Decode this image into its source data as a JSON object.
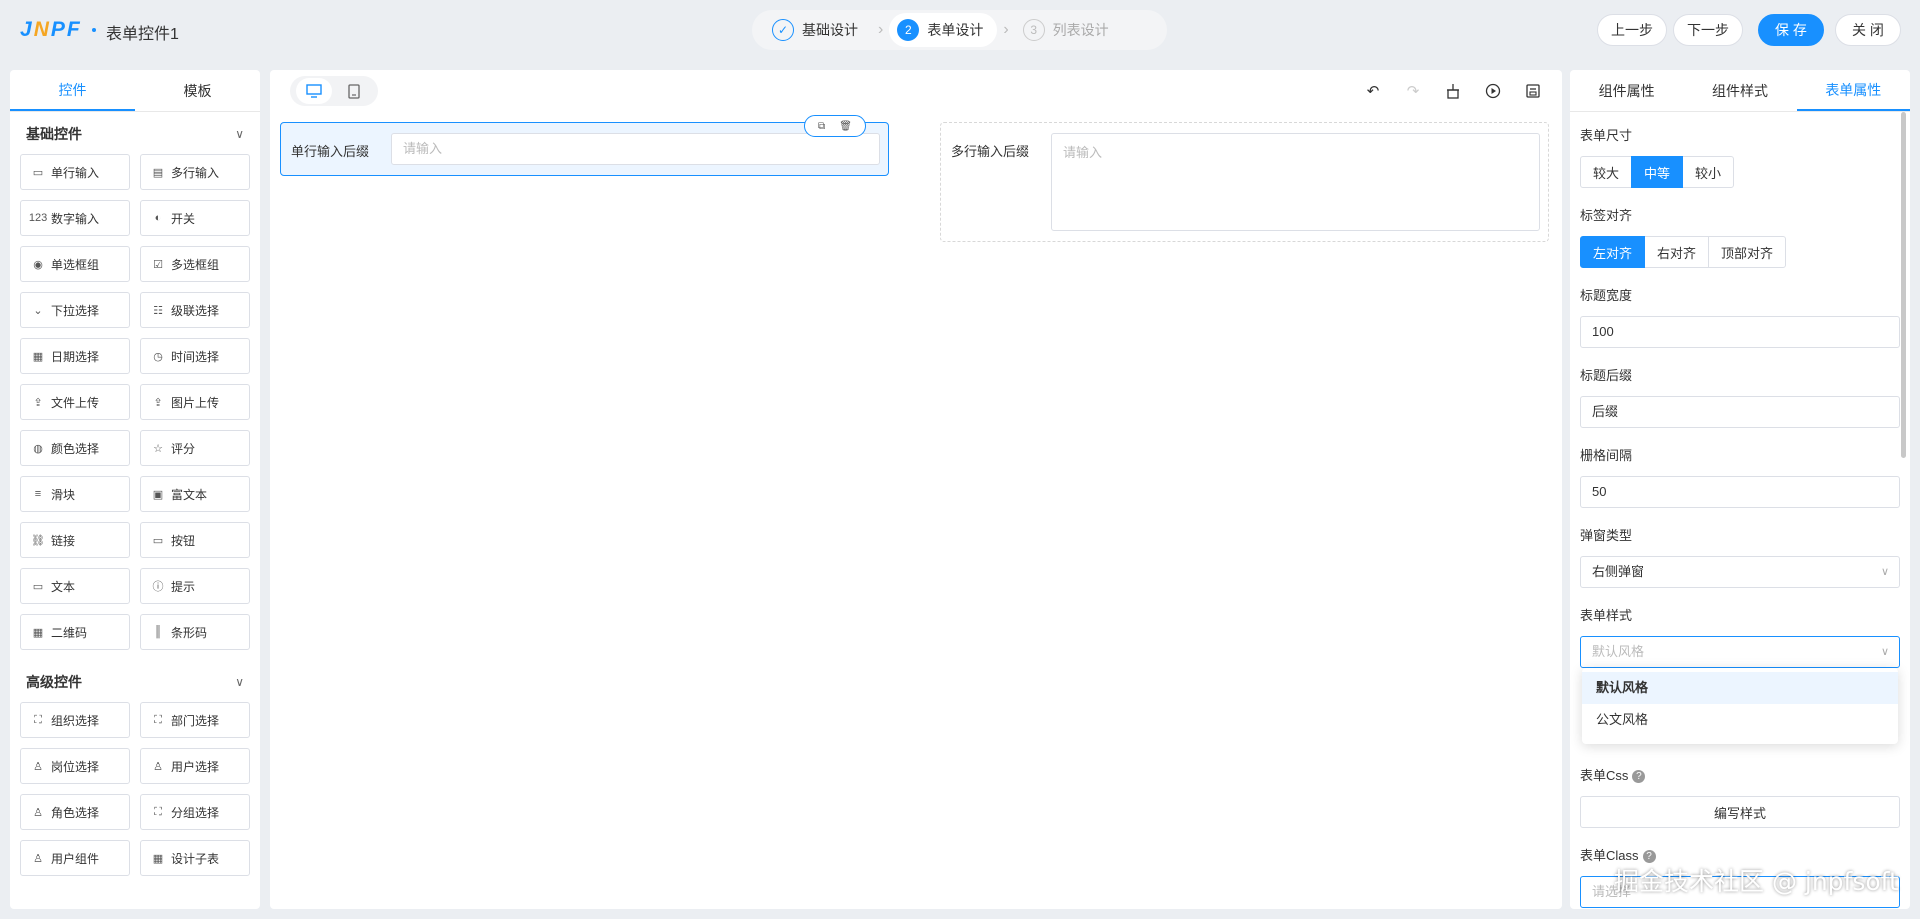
{
  "header": {
    "logo": "JNPF",
    "form_name": "表单控件1",
    "steps": [
      {
        "num": "✓",
        "label": "基础设计",
        "state": "done"
      },
      {
        "num": "2",
        "label": "表单设计",
        "state": "active"
      },
      {
        "num": "3",
        "label": "列表设计",
        "state": "todo"
      }
    ],
    "prev_label": "上一步",
    "next_label": "下一步",
    "save_label": "保 存",
    "close_label": "关 闭"
  },
  "left": {
    "tabs": [
      "控件",
      "模板"
    ],
    "basic_title": "基础控件",
    "basic": [
      {
        "label": "单行输入",
        "icon": "▭"
      },
      {
        "label": "多行输入",
        "icon": "▤"
      },
      {
        "label": "数字输入",
        "icon": "123"
      },
      {
        "label": "开关",
        "icon": "◐"
      },
      {
        "label": "单选框组",
        "icon": "◉"
      },
      {
        "label": "多选框组",
        "icon": "☑"
      },
      {
        "label": "下拉选择",
        "icon": "⌄"
      },
      {
        "label": "级联选择",
        "icon": "☷"
      },
      {
        "label": "日期选择",
        "icon": "▦"
      },
      {
        "label": "时间选择",
        "icon": "◷"
      },
      {
        "label": "文件上传",
        "icon": "⇪"
      },
      {
        "label": "图片上传",
        "icon": "⇪"
      },
      {
        "label": "颜色选择",
        "icon": "◍"
      },
      {
        "label": "评分",
        "icon": "☆"
      },
      {
        "label": "滑块",
        "icon": "≡"
      },
      {
        "label": "富文本",
        "icon": "▣"
      },
      {
        "label": "链接",
        "icon": "⛓"
      },
      {
        "label": "按钮",
        "icon": "▭"
      },
      {
        "label": "文本",
        "icon": "▭"
      },
      {
        "label": "提示",
        "icon": "ⓘ"
      },
      {
        "label": "二维码",
        "icon": "▦"
      },
      {
        "label": "条形码",
        "icon": "║"
      }
    ],
    "advanced_title": "高级控件",
    "advanced": [
      {
        "label": "组织选择",
        "icon": "⛶"
      },
      {
        "label": "部门选择",
        "icon": "⛶"
      },
      {
        "label": "岗位选择",
        "icon": "♙"
      },
      {
        "label": "用户选择",
        "icon": "♙"
      },
      {
        "label": "角色选择",
        "icon": "♙"
      },
      {
        "label": "分组选择",
        "icon": "⛶"
      },
      {
        "label": "用户组件",
        "icon": "♙"
      },
      {
        "label": "设计子表",
        "icon": "▦"
      }
    ]
  },
  "canvas": {
    "field1_label": "单行输入后缀",
    "field1_placeholder": "请输入",
    "field2_label": "多行输入后缀",
    "field2_placeholder": "请输入"
  },
  "right": {
    "tabs": [
      "组件属性",
      "组件样式",
      "表单属性"
    ],
    "size_label": "表单尺寸",
    "size_options": [
      "较大",
      "中等",
      "较小"
    ],
    "size_selected": 1,
    "align_label": "标签对齐",
    "align_options": [
      "左对齐",
      "右对齐",
      "顶部对齐"
    ],
    "align_selected": 0,
    "title_width_label": "标题宽度",
    "title_width_value": "100",
    "title_suffix_label": "标题后缀",
    "title_suffix_value": "后缀",
    "gutter_label": "栅格间隔",
    "gutter_value": "50",
    "popup_label": "弹窗类型",
    "popup_value": "右侧弹窗",
    "style_label": "表单样式",
    "style_placeholder": "默认风格",
    "style_options": [
      "默认风格",
      "公文风格"
    ],
    "css_label": "表单Css",
    "css_button": "编写样式",
    "class_label": "表单Class",
    "class_placeholder": "请选择"
  },
  "watermark": "掘金技术社区 @ jnpfsoft"
}
